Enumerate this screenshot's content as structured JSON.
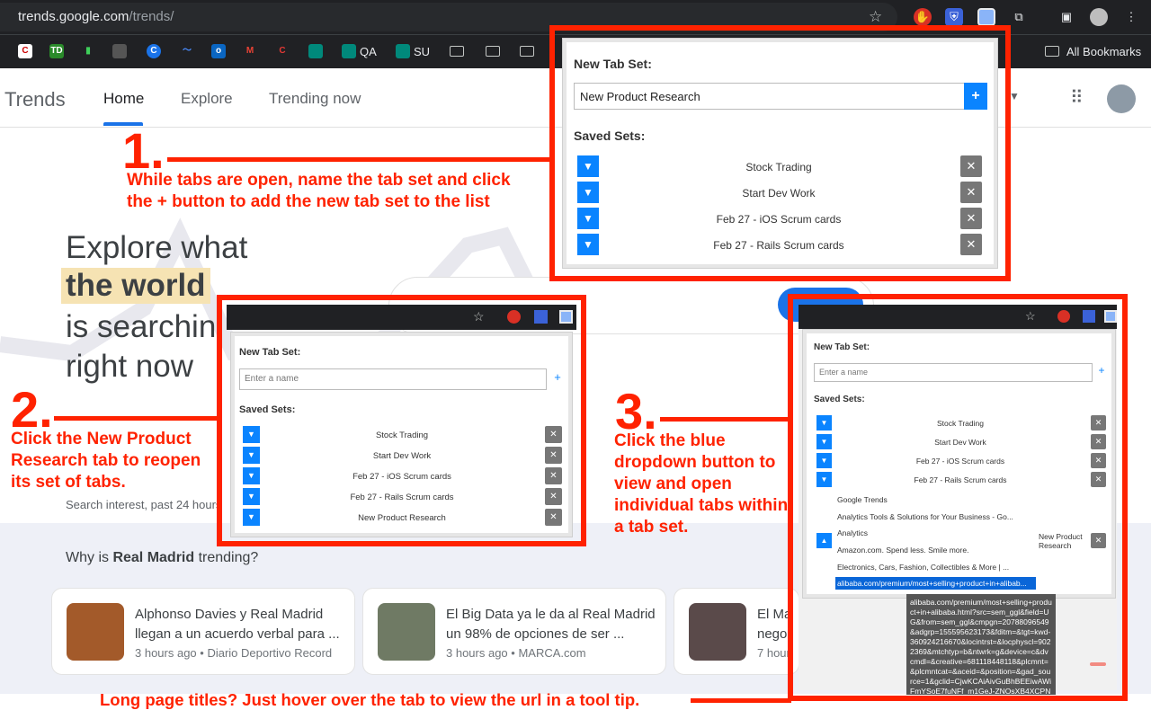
{
  "browser": {
    "url_host": "trends.google.com",
    "url_path": "/trends/",
    "bookmarks": [
      "QA",
      "SU",
      "All Bookmarks"
    ]
  },
  "page": {
    "brand": "Trends",
    "nav": [
      "Home",
      "Explore",
      "Trending now"
    ],
    "hero": [
      "Explore what",
      "the world",
      "is searchin",
      "right now"
    ],
    "search_note": "Search interest, past 24 hours",
    "why_prefix": "Why is ",
    "why_topic": "Real Madrid",
    "why_suffix": " trending?",
    "cards": [
      {
        "title": "Alphonso Davies y Real Madrid llegan a un acuerdo verbal para ...",
        "meta": "3 hours ago • Diario Deportivo Record"
      },
      {
        "title": "El Big Data ya le da al Real Madrid un 98% de opciones de ser ...",
        "meta": "3 hours ago • MARCA.com"
      },
      {
        "title": "El Ma nego",
        "meta": "7 hour"
      }
    ]
  },
  "annotations": {
    "step1_num": "1.",
    "step1_text": "While tabs are open, name the tab set and click the + button to add the new tab set to the list",
    "step2_num": "2.",
    "step2_text": "Click the New Product Research tab to reopen its set of tabs.",
    "step3_num": "3.",
    "step3_text": "Click the blue dropdown button to view and open individual tabs within a tab set.",
    "footer": "Long page titles? Just hover over the tab to view the url in a tool tip."
  },
  "popup1": {
    "new_label": "New Tab Set:",
    "input_value": "New Product Research",
    "plus": "+",
    "saved_label": "Saved Sets:",
    "sets": [
      "Stock Trading",
      "Start Dev Work",
      "Feb 27 - iOS Scrum cards",
      "Feb 27 - Rails Scrum cards"
    ]
  },
  "popup2": {
    "new_label": "New Tab Set:",
    "placeholder": "Enter a name",
    "plus": "+",
    "saved_label": "Saved Sets:",
    "sets": [
      "Stock Trading",
      "Start Dev Work",
      "Feb 27 - iOS Scrum cards",
      "Feb 27 - Rails Scrum cards",
      "New Product Research"
    ]
  },
  "popup3": {
    "new_label": "New Tab Set:",
    "placeholder": "Enter a name",
    "plus": "+",
    "saved_label": "Saved Sets:",
    "sets": [
      "Stock Trading",
      "Start Dev Work",
      "Feb 27 - iOS Scrum cards",
      "Feb 27 - Rails Scrum cards"
    ],
    "expanded_set": "New Product Research",
    "tabs": [
      "Google Trends",
      "Analytics Tools & Solutions for Your Business - Go...",
      "Analytics",
      "Amazon.com. Spend less. Smile more.",
      "Electronics, Cars, Fashion, Collectibles & More | ...",
      "alibaba.com/premium/most+selling+product+in+alibab..."
    ],
    "tooltip": "alibaba.com/premium/most+selling+product+in+alibaba.html?src=sem_ggl&field=UG&from=sem_ggl&cmpgn=20788096549&adgrp=155595623173&fditm=&tgt=kwd-360924216670&locintrst=&locphyscl=9022369&mtchtyp=b&ntwrk=g&device=c&dvcmdl=&creative=681118448118&plcmnt=&plcmntcat=&aceid=&position=&gad_source=1&gclid=CjwKCAiAivGuBhBEEiwAWiFmYSoE7fuNFf_m1GeJ-ZNOsXB4XCPNIpfB1ayozrbF6kDFQQh2kR5x6RoCARYQAvD_BwE"
  },
  "colors": {
    "accent": "#0a84ff",
    "annotation": "#ff2200"
  }
}
